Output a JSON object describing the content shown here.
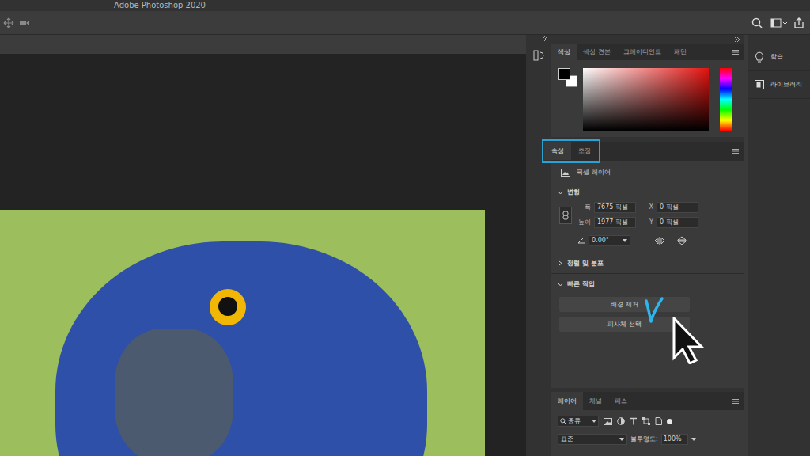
{
  "window": {
    "title": "Adobe Photoshop 2020"
  },
  "color_panel": {
    "tabs": [
      {
        "label": "색상",
        "selected": true
      },
      {
        "label": "색상 견본",
        "selected": false
      },
      {
        "label": "그레이디언트",
        "selected": false
      },
      {
        "label": "패턴",
        "selected": false
      }
    ]
  },
  "properties_panel": {
    "tabs": [
      {
        "label": "속성",
        "selected": true
      },
      {
        "label": "조정",
        "selected": false
      }
    ],
    "layer_kind": "픽셀 레이어",
    "transform": {
      "title": "변형",
      "expanded": true,
      "fields": [
        {
          "label": "폭",
          "value": "7675 픽셀"
        },
        {
          "label": "X",
          "value": "0 픽셀"
        },
        {
          "label": "높이",
          "value": "1977 픽셀"
        },
        {
          "label": "Y",
          "value": "0 픽셀"
        }
      ],
      "angle": "0.00°"
    },
    "align": {
      "title": "정렬 및 분포",
      "expanded": false
    },
    "quick_actions": {
      "title": "빠른 작업",
      "expanded": true,
      "buttons": [
        {
          "label": "배경 제거",
          "checked": true
        },
        {
          "label": "피사체 선택",
          "checked": false
        }
      ]
    }
  },
  "layers_panel": {
    "tabs": [
      {
        "label": "레이어",
        "selected": true
      },
      {
        "label": "채널",
        "selected": false
      },
      {
        "label": "패스",
        "selected": false
      }
    ],
    "filter": "종류",
    "blend_mode": "표준",
    "opacity_label": "불투명도:",
    "opacity": "100%"
  },
  "side_panel": {
    "items": [
      {
        "label": "학습"
      },
      {
        "label": "라이브러리"
      }
    ]
  }
}
